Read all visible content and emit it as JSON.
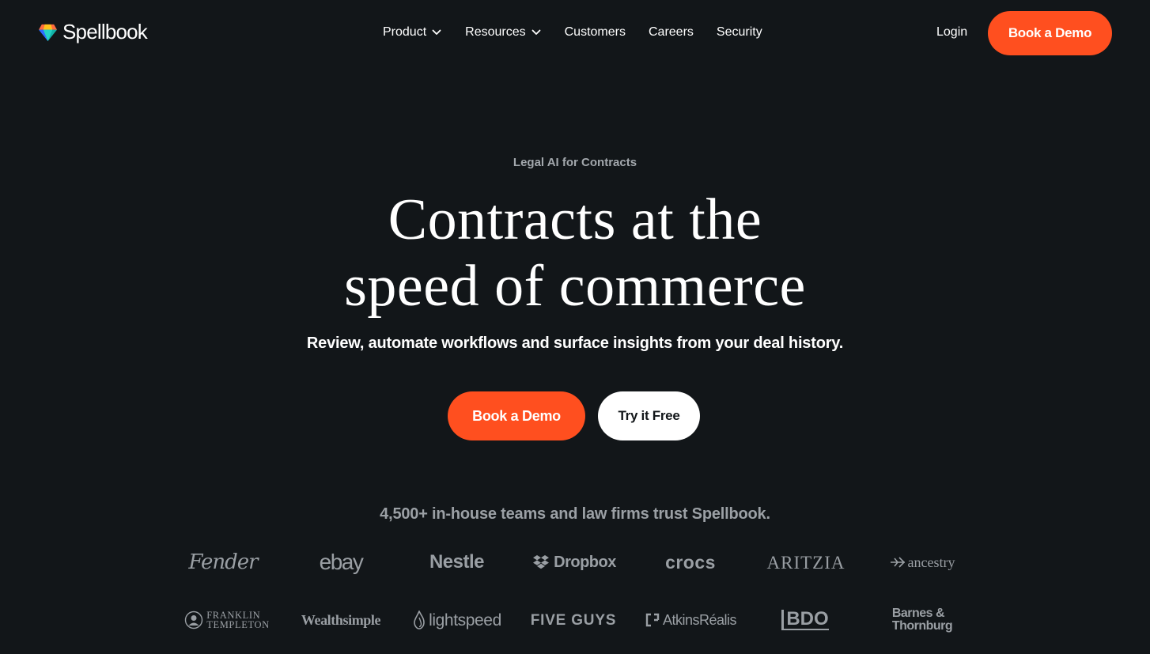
{
  "brand": {
    "name": "Spellbook",
    "logo_icon": "gem-icon",
    "colors": {
      "gem_top": "#ff6b3d",
      "gem_mid": "#ffc21a",
      "gem_side": "#2f6bff",
      "gem_bottom": "#12b3a8"
    }
  },
  "nav": {
    "items": [
      {
        "label": "Product",
        "has_dropdown": true
      },
      {
        "label": "Resources",
        "has_dropdown": true
      },
      {
        "label": "Customers",
        "has_dropdown": false
      },
      {
        "label": "Careers",
        "has_dropdown": false
      },
      {
        "label": "Security",
        "has_dropdown": false
      }
    ],
    "login_label": "Login",
    "cta_label": "Book a Demo"
  },
  "hero": {
    "eyebrow": "Legal AI for Contracts",
    "headline_line1": "Contracts at the",
    "headline_line2": "speed of commerce",
    "subhead": "Review, automate workflows and surface insights from your deal history.",
    "primary_cta": "Book a Demo",
    "secondary_cta": "Try it Free"
  },
  "trust": {
    "text": "4,500+ in-house teams and law firms trust Spellbook.",
    "logos_row1": [
      "Fender",
      "ebay",
      "Nestle",
      "Dropbox",
      "crocs",
      "ARITZIA",
      "ancestry"
    ],
    "logos_row2": [
      "FRANKLIN",
      "TEMPLETON",
      "Wealthsimple",
      "lightspeed",
      "FIVE GUYS",
      "AtkinsRéalis",
      "BDO",
      "Barnes &",
      "Thornburg"
    ]
  },
  "colors": {
    "background": "#121619",
    "accent": "#ff4f1f",
    "text": "#ffffff",
    "muted": "#9ba0a5"
  }
}
